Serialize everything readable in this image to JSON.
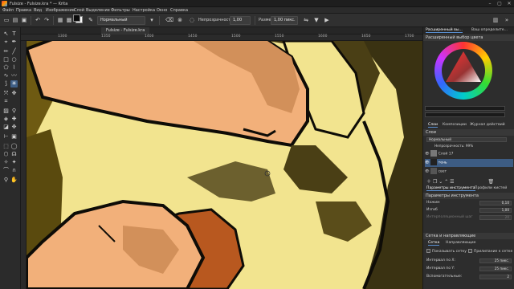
{
  "window": {
    "title": "Fulsize - Fulsize.kra * — Krita",
    "controls": [
      "–",
      "▢",
      "✕"
    ]
  },
  "menu": [
    "Файл",
    "Правка",
    "Вид",
    "Изображение",
    "Слой",
    "Выделение",
    "Фильтры",
    "Настройка",
    "Окно",
    "Справка"
  ],
  "toolbar": {
    "blend_mode": "Нормальный",
    "opacity_label": "Непрозрачность:",
    "opacity_value": "1,00",
    "size_label": "Размер:",
    "size_value": "1,00 пикс."
  },
  "document": {
    "tab_title": "Fulsize - Fulsize.kra"
  },
  "ruler": [
    "1300",
    "1350",
    "1400",
    "1450",
    "1500",
    "1550",
    "1600",
    "1650",
    "1700"
  ],
  "docker": {
    "top_tabs": [
      "Расширенный вы...",
      "Ваш определите..."
    ],
    "color_selector_title": "Расширенный выбор цвета",
    "tabs": [
      "Слои",
      "Композиции",
      "Журнал действий"
    ],
    "layers_title": "Слои",
    "layer_blend": "Нормальный",
    "layer_opacity": "Непрозрачность: 99%",
    "layers": [
      {
        "name": "Слой 17",
        "selected": false
      },
      {
        "name": "тень",
        "selected": true
      },
      {
        "name": "свет",
        "selected": false
      }
    ],
    "tool_tabs": [
      "Параметры инструмента",
      "Профили кистей"
    ],
    "tool_options_title": "Параметры инструмента",
    "params": [
      {
        "label": "Нажим",
        "value": "0,10"
      },
      {
        "label": "Изгиб",
        "value": "1,00"
      },
      {
        "label": "Интерполяционный шаг",
        "value": "20"
      }
    ],
    "grid_title": "Сетка и направляющие",
    "grid_tabs": [
      "Сетка",
      "Направляющие"
    ],
    "grid_options": [
      {
        "label": "Показывать сетку",
        "value": ""
      },
      {
        "label": "Прилипание к сетке",
        "value": ""
      },
      {
        "label": "Интервал по X:",
        "value": "25 пикс."
      },
      {
        "label": "Интервал по Y:",
        "value": "25 пикс."
      },
      {
        "label": "Вспомогательные:",
        "value": "2"
      }
    ]
  },
  "colors": {
    "fill_primary": "#ffe9b2",
    "fill_shirt": "#f2e48f",
    "fill_shirt_shadow": "#3a3212",
    "fill_skin": "#f2b07a",
    "fill_hair": "#b8581f",
    "ink": "#0e0c07",
    "accent": "#3d5c83"
  }
}
